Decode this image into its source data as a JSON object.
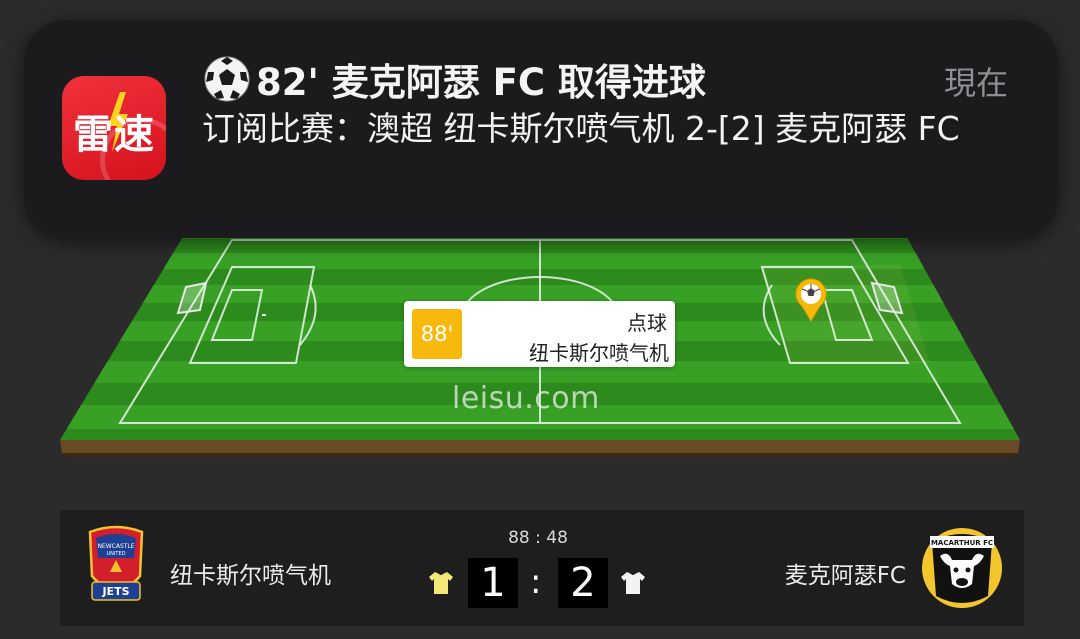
{
  "notification": {
    "app_icon_text": "雷速",
    "title": "82' 麦克阿瑟 FC 取得进球",
    "time": "現在",
    "body": "订阅比赛：澳超 纽卡斯尔喷气机 2-[2] 麦克阿瑟 FC",
    "icons": {
      "title": "soccer-ball-icon",
      "app": "leisu-app-icon"
    }
  },
  "pitch": {
    "watermark": "leisu.com",
    "event": {
      "minute": "88'",
      "type": "点球",
      "team": "纽卡斯尔喷气机"
    },
    "colors": {
      "grass_dark": "#2e8c1e",
      "grass_light": "#3aa327",
      "event_badge": "#f8b90e"
    }
  },
  "match": {
    "clock": "88 : 48",
    "home": {
      "name": "纽卡斯尔喷气机",
      "score": "1",
      "crest_text": "JETS",
      "jersey_color": "#f3e97a"
    },
    "away": {
      "name": "麦克阿瑟FC",
      "score": "2",
      "crest_text": "MACARTHUR FC",
      "jersey_color": "#f2f2f2"
    },
    "separator": ":"
  }
}
